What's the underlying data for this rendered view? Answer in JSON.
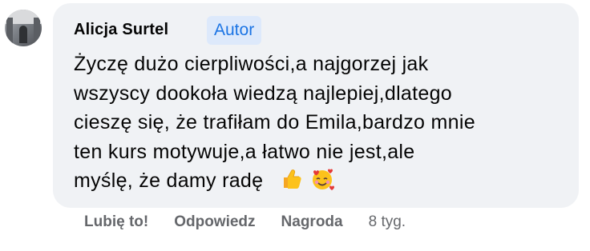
{
  "comment": {
    "author": "Alicja Surtel",
    "badge": "Autor",
    "lines": [
      "Życzę dużo cierpliwości,a najgorzej jak",
      "wszyscy dookoła wiedzą najlepiej,dlatego",
      "cieszę się, że trafiłam do Emila,bardzo mnie",
      "ten kurs motywuje,a łatwo nie jest,ale",
      "myślę, że damy radę"
    ],
    "emojis": [
      "thumbs-up-icon",
      "smiling-face-with-hearts-icon"
    ]
  },
  "actions": {
    "like": "Lubię to!",
    "reply": "Odpowiedz",
    "award": "Nagroda",
    "time": "8 tyg."
  },
  "colors": {
    "bubble": "#f0f2f5",
    "badge_bg": "#dde9fb",
    "badge_text": "#1b74e4",
    "meta": "#65676b"
  }
}
